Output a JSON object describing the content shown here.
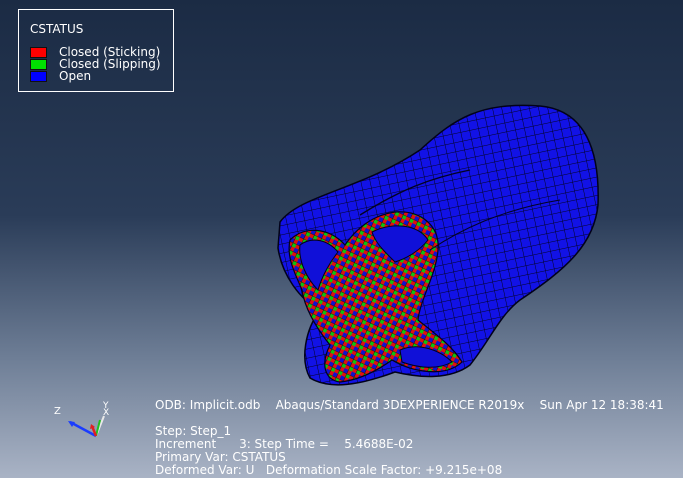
{
  "legend": {
    "title": "CSTATUS",
    "items": [
      {
        "label": "Closed (Sticking)",
        "color": "#ff0000"
      },
      {
        "label": "Closed (Slipping)",
        "color": "#00e000"
      },
      {
        "label": "Open",
        "color": "#0000ff"
      }
    ]
  },
  "info": {
    "odb_line": "ODB: Implicit.odb    Abaqus/Standard 3DEXPERIENCE R2019x    Sun Apr 12 18:38:41",
    "step": "Step: Step_1",
    "increment": "Increment      3: Step Time =    5.4688E-02",
    "primary_var": "Primary Var: CSTATUS",
    "deformed_var": "Deformed Var: U   Deformation Scale Factor: +9.215e+08"
  },
  "triad": {
    "z_label": "Z",
    "y_label": "Y",
    "x_label": "X"
  },
  "colors": {
    "mesh_blue": "#1010e0",
    "edge": "#05051a",
    "sticking": "#ff0000",
    "slipping": "#00e000"
  }
}
